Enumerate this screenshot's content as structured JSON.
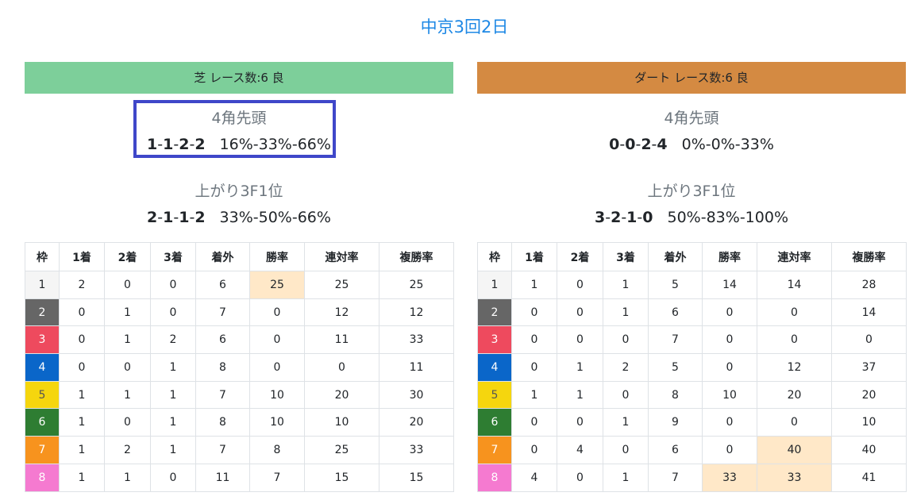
{
  "title": "中京3回2日",
  "panels": [
    {
      "band": "芝 レース数:6  良",
      "stat_a_label": "4角先頭",
      "stat_a_counts": [
        "1",
        "1",
        "2",
        "2"
      ],
      "stat_a_pct": "16%-33%-66%",
      "stat_b_label": "上がり3F1位",
      "stat_b_counts": [
        "2",
        "1",
        "1",
        "2"
      ],
      "stat_b_pct": "33%-50%-66%",
      "headers": [
        "枠",
        "1着",
        "2着",
        "3着",
        "着外",
        "勝率",
        "連対率",
        "複勝率"
      ],
      "rows": [
        [
          "1",
          "2",
          "0",
          "0",
          "6",
          "25",
          "25",
          "25"
        ],
        [
          "2",
          "0",
          "1",
          "0",
          "7",
          "0",
          "12",
          "12"
        ],
        [
          "3",
          "0",
          "1",
          "2",
          "6",
          "0",
          "11",
          "33"
        ],
        [
          "4",
          "0",
          "0",
          "1",
          "8",
          "0",
          "0",
          "11"
        ],
        [
          "5",
          "1",
          "1",
          "1",
          "7",
          "10",
          "20",
          "30"
        ],
        [
          "6",
          "1",
          "0",
          "1",
          "8",
          "10",
          "10",
          "20"
        ],
        [
          "7",
          "1",
          "2",
          "1",
          "7",
          "8",
          "25",
          "33"
        ],
        [
          "8",
          "1",
          "1",
          "0",
          "11",
          "7",
          "15",
          "15"
        ]
      ]
    },
    {
      "band": "ダート レース数:6  良",
      "stat_a_label": "4角先頭",
      "stat_a_counts": [
        "0",
        "0",
        "2",
        "4"
      ],
      "stat_a_pct": "0%-0%-33%",
      "stat_b_label": "上がり3F1位",
      "stat_b_counts": [
        "3",
        "2",
        "1",
        "0"
      ],
      "stat_b_pct": "50%-83%-100%",
      "headers": [
        "枠",
        "1着",
        "2着",
        "3着",
        "着外",
        "勝率",
        "連対率",
        "複勝率"
      ],
      "rows": [
        [
          "1",
          "1",
          "0",
          "1",
          "5",
          "14",
          "14",
          "28"
        ],
        [
          "2",
          "0",
          "0",
          "1",
          "6",
          "0",
          "0",
          "14"
        ],
        [
          "3",
          "0",
          "0",
          "0",
          "7",
          "0",
          "0",
          "0"
        ],
        [
          "4",
          "0",
          "1",
          "2",
          "5",
          "0",
          "12",
          "37"
        ],
        [
          "5",
          "1",
          "1",
          "0",
          "8",
          "10",
          "20",
          "20"
        ],
        [
          "6",
          "0",
          "0",
          "1",
          "9",
          "0",
          "0",
          "10"
        ],
        [
          "7",
          "0",
          "4",
          "0",
          "6",
          "0",
          "40",
          "40"
        ],
        [
          "8",
          "4",
          "0",
          "1",
          "7",
          "33",
          "33",
          "41"
        ]
      ]
    }
  ]
}
